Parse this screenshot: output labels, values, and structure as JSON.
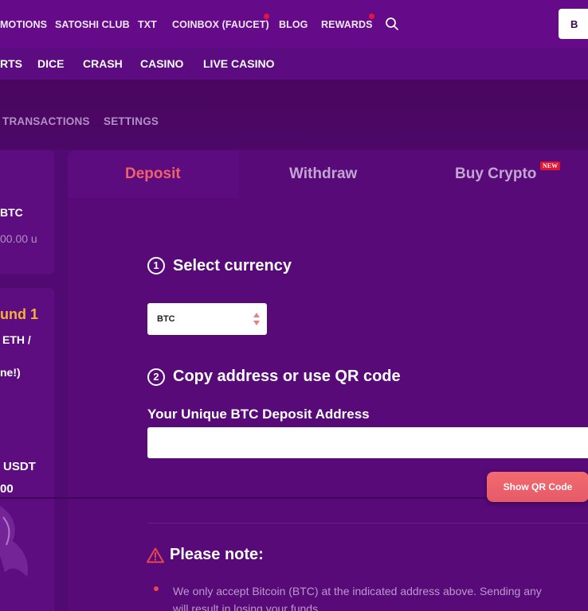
{
  "top_nav": {
    "items": [
      "MOTIONS",
      "SATOSHI CLUB",
      "TXT",
      "COINBOX (FAUCET)",
      "BLOG",
      "REWARDS"
    ],
    "currency_button": "B",
    "colors": {
      "background": "#650b8a",
      "notification_dot": "#e8123e"
    }
  },
  "game_nav": {
    "items": [
      "RTS",
      "DICE",
      "CRASH",
      "CASINO",
      "LIVE CASINO"
    ]
  },
  "account_tabs": {
    "items": [
      "TRANSACTIONS",
      "SETTINGS"
    ]
  },
  "left_panel": {
    "card1": {
      "line1": "BTC",
      "line2": "00.00 u"
    },
    "card2": {
      "line1": "und 1",
      "line2": "ETH /",
      "line3": "ne!)",
      "line4": "USDT",
      "line5": "00"
    }
  },
  "wallet": {
    "tabs": [
      {
        "label": "Deposit",
        "active": true
      },
      {
        "label": "Withdraw",
        "active": false
      },
      {
        "label": "Buy Crypto",
        "active": false,
        "badge": "NEW"
      }
    ],
    "step1": {
      "number": "1",
      "title": "Select currency"
    },
    "currency_select": {
      "value": "BTC"
    },
    "step2": {
      "number": "2",
      "title": "Copy address or use QR code"
    },
    "address_label": "Your Unique BTC Deposit Address",
    "address_value": "",
    "qr_button": "Show QR Code",
    "note": {
      "title": "Please note:",
      "text_line1": "We only accept Bitcoin (BTC) at the indicated address above. Sending any",
      "text_line2": "will result in losing your funds."
    },
    "colors": {
      "active_tab": "#f0616a",
      "inactive_tab": "#c2a5d3",
      "accent": "#e8474f"
    }
  }
}
